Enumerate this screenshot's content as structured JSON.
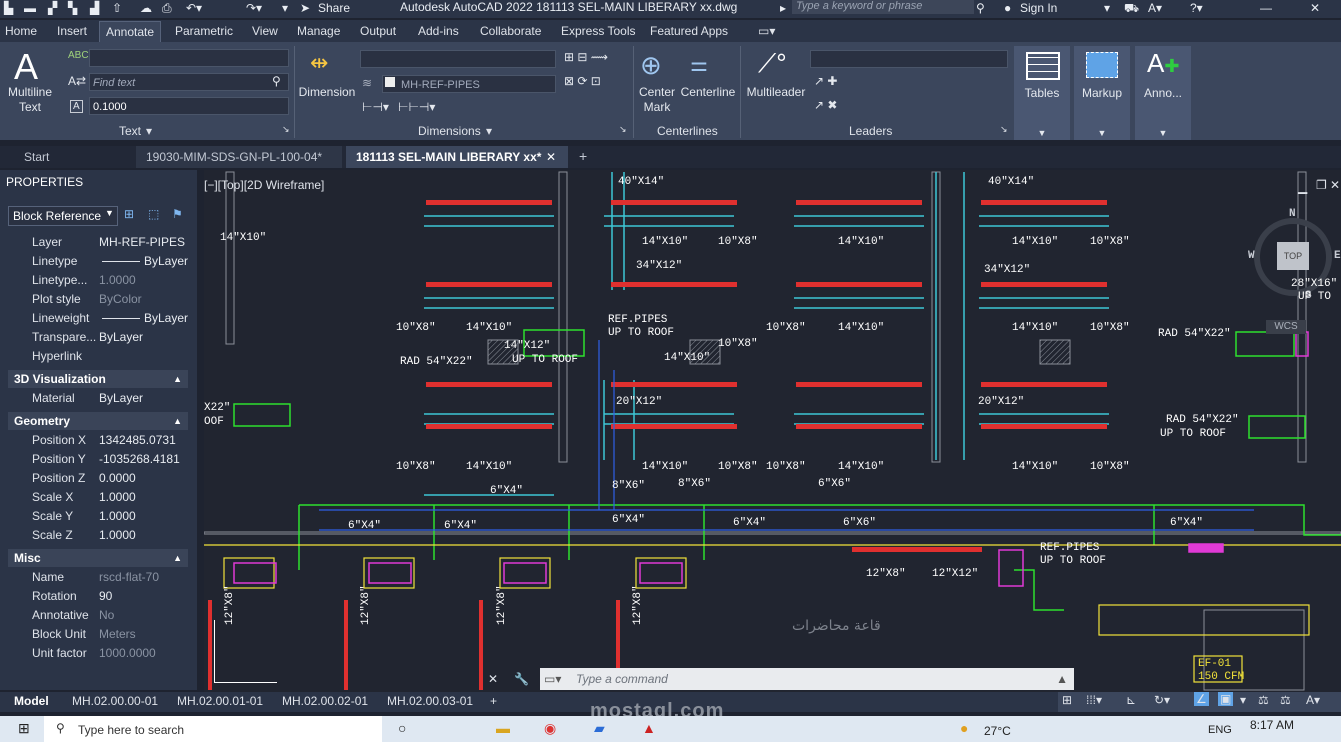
{
  "window": {
    "title": "Autodesk AutoCAD 2022   181113 SEL-MAIN LIBERARY xx.dwg",
    "share_label": "Share",
    "search_placeholder": "Type a keyword or phrase",
    "sign_in": "Sign In"
  },
  "ribbon_tabs": [
    "Home",
    "Insert",
    "Annotate",
    "Parametric",
    "View",
    "Manage",
    "Output",
    "Add-ins",
    "Collaborate",
    "Express Tools",
    "Featured Apps"
  ],
  "ribbon": {
    "text_panel": {
      "multiline_text": "Multiline\nText",
      "find_placeholder": "Find text",
      "text_height": "0.1000",
      "title": "Text"
    },
    "dimensions_panel": {
      "dimension": "Dimension",
      "layer_combo": "MH-REF-PIPES",
      "title": "Dimensions"
    },
    "centerlines_panel": {
      "center_mark": "Center\nMark",
      "centerline": "Centerline",
      "title": "Centerlines"
    },
    "leaders_panel": {
      "multileader": "Multileader",
      "title": "Leaders"
    },
    "tables": "Tables",
    "markup": "Markup",
    "annotation": "Anno..."
  },
  "doc_tabs": {
    "start": "Start",
    "tab1": "19030-MIM-SDS-GN-PL-100-04*",
    "tab2": "181113 SEL-MAIN LIBERARY xx*"
  },
  "properties": {
    "title": "PROPERTIES",
    "selection": "Block Reference",
    "general": [
      {
        "key": "Layer",
        "value": "MH-REF-PIPES"
      },
      {
        "key": "Linetype",
        "value": "ByLayer"
      },
      {
        "key": "Linetype...",
        "value": "1.0000"
      },
      {
        "key": "Plot style",
        "value": "ByColor"
      },
      {
        "key": "Lineweight",
        "value": "ByLayer"
      },
      {
        "key": "Transpare...",
        "value": "ByLayer"
      },
      {
        "key": "Hyperlink",
        "value": ""
      }
    ],
    "section_3d": "3D Visualization",
    "material": {
      "key": "Material",
      "value": "ByLayer"
    },
    "section_geometry": "Geometry",
    "geometry": [
      {
        "key": "Position X",
        "value": "1342485.0731"
      },
      {
        "key": "Position Y",
        "value": "-1035268.4181"
      },
      {
        "key": "Position Z",
        "value": "0.0000"
      },
      {
        "key": "Scale X",
        "value": "1.0000"
      },
      {
        "key": "Scale Y",
        "value": "1.0000"
      },
      {
        "key": "Scale Z",
        "value": "1.0000"
      }
    ],
    "section_misc": "Misc",
    "misc": [
      {
        "key": "Name",
        "value": "rscd-flat-70"
      },
      {
        "key": "Rotation",
        "value": "90"
      },
      {
        "key": "Annotative",
        "value": "No"
      },
      {
        "key": "Block Unit",
        "value": "Meters"
      },
      {
        "key": "Unit factor",
        "value": "1000.0000"
      }
    ]
  },
  "viewport": {
    "label": "[−][Top][2D Wireframe]",
    "viewcube": {
      "n": "N",
      "s": "S",
      "e": "E",
      "w": "W",
      "top": "TOP",
      "wcs": "WCS"
    },
    "annotations": [
      "14\"X10\"",
      "40\"X14\"",
      "40\"X14\"",
      "14\"X10\"",
      "10\"X8\"",
      "14\"X10\"",
      "14\"X10\"",
      "10\"X8\"",
      "34\"X12\"",
      "34\"X12\"",
      "28\"X16\"",
      "UP TO",
      "10\"X8\"",
      "14\"X10\"",
      "REF.PIPES",
      "UP TO ROOF",
      "10\"X8\"",
      "14\"X10\"",
      "14\"X10\"",
      "10\"X8\"",
      "RAD 54\"X22\"",
      "14\"X12\"",
      "UP TO ROOF",
      "10\"X8\"",
      "14\"X10\"",
      "RAD 54\"X22\"",
      "X22\"",
      "OOF",
      "20\"X12\"",
      "20\"X12\"",
      "RAD 54\"X22\"",
      "UP TO ROOF",
      "10\"X8\"",
      "14\"X10\"",
      "14\"X10\"",
      "10\"X8\"",
      "10\"X8\"",
      "14\"X10\"",
      "14\"X10\"",
      "10\"X8\"",
      "6\"X4\"",
      "8\"X6\"",
      "6\"X6\"",
      "8\"X6\"",
      "6\"X4\"",
      "6\"X4\"",
      "6\"X4\"",
      "6\"X4\"",
      "6\"X6\"",
      "6\"X4\"",
      "REF.PIPES",
      "UP TO ROOF",
      "12\"X8\"",
      "12\"X12\"",
      "12\"X8\"",
      "12\"X8\"",
      "12\"X8\"",
      "12\"X8\"",
      "EF-01",
      "150 CFM",
      "قاعة محاضرات"
    ]
  },
  "command_line": {
    "placeholder": "Type a command"
  },
  "layout_tabs": [
    "Model",
    "MH.02.00.00-01",
    "MH.02.00.01-01",
    "MH.02.00.02-01",
    "MH.02.00.03-01"
  ],
  "taskbar": {
    "search_placeholder": "Type here to search",
    "temperature": "27°C",
    "language": "ENG",
    "time": "8:17 AM"
  },
  "watermark": "mostaql.com"
}
